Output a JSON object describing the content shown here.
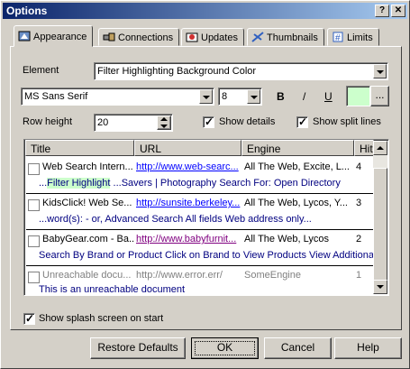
{
  "window": {
    "title": "Options",
    "help_glyph": "?",
    "close_glyph": "✕"
  },
  "tabs": [
    {
      "label": "Appearance",
      "icon": "appearance-icon"
    },
    {
      "label": "Connections",
      "icon": "connections-icon"
    },
    {
      "label": "Updates",
      "icon": "updates-icon"
    },
    {
      "label": "Thumbnails",
      "icon": "thumbnails-icon"
    },
    {
      "label": "Limits",
      "icon": "limits-icon"
    }
  ],
  "element": {
    "label": "Element",
    "value": "Filter Highlighting Background Color"
  },
  "font": {
    "family": "MS Sans Serif",
    "size": "8",
    "bold": "B",
    "italic": "/",
    "underline": "U",
    "color": "#ccffcc",
    "more": "..."
  },
  "row_height": {
    "label": "Row height",
    "value": "20"
  },
  "options": {
    "show_details": "Show details",
    "show_split_lines": "Show split lines",
    "show_splash": "Show splash screen on start"
  },
  "list": {
    "columns": [
      "Title",
      "URL",
      "Engine",
      "Hits"
    ],
    "rows": [
      {
        "title": "Web Search Intern...",
        "url": "http://www.web-searc...",
        "engine": "All The Web, Excite, L...",
        "hits": "4",
        "snippet_prefix": "...",
        "snippet_highlight": "Filter Highlight",
        "snippet_rest": " ...Savers | Photography Search For: Open Directory"
      },
      {
        "title": "KidsClick! Web Se...",
        "url": "http://sunsite.berkeley...",
        "engine": "All The Web, Lycos, Y...",
        "hits": "3",
        "snippet": "...word(s): - or, Advanced Search All fields Web address only..."
      },
      {
        "title": "BabyGear.com - Ba...",
        "url": "http://www.babyfurnit...",
        "engine": "All The Web, Lycos",
        "hits": "2",
        "snippet": "Search By Brand or Product Click on Brand to View Products View Additional"
      },
      {
        "title": "Unreachable docu...",
        "url": "http://www.error.err/",
        "engine": "SomeEngine",
        "hits": "1",
        "snippet": "This is an unreachable document"
      }
    ]
  },
  "buttons": {
    "restore": "Restore Defaults",
    "ok": "OK",
    "cancel": "Cancel",
    "help": "Help"
  },
  "colors": {
    "title_start": "#0a246a",
    "title_end": "#a6caf0",
    "highlight_bg": "#ccffcc",
    "link": "#0000ff"
  }
}
